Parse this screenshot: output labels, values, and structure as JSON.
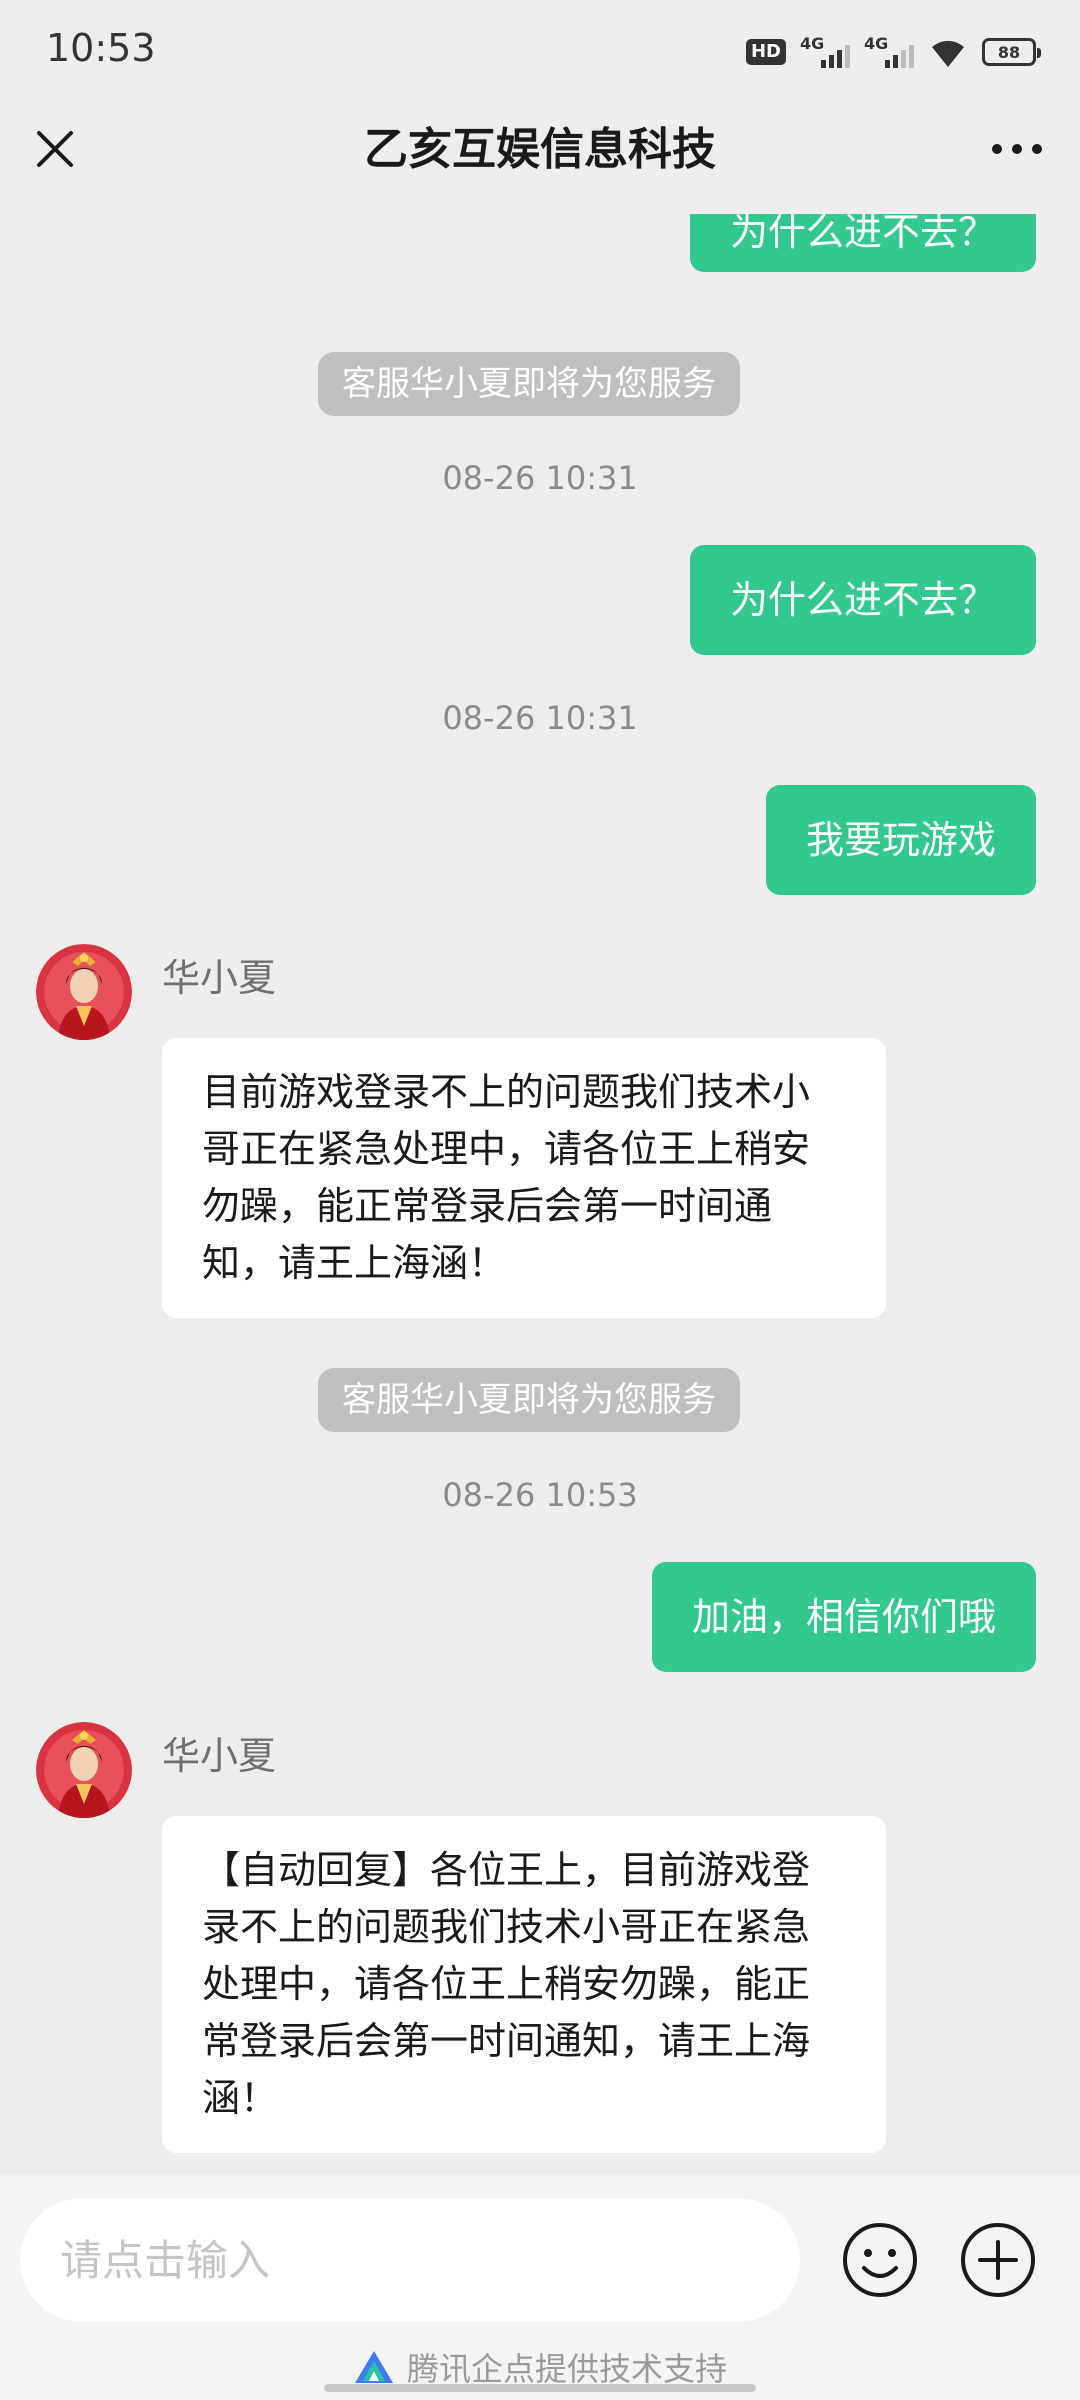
{
  "status_bar": {
    "time": "10:53",
    "hd_label": "HD",
    "network1": "4G",
    "network2": "4G",
    "battery": "88"
  },
  "header": {
    "title": "乙亥互娱信息科技"
  },
  "messages": [
    {
      "type": "out",
      "text": "为什么进不去？"
    },
    {
      "type": "system",
      "text": "客服华小夏即将为您服务"
    },
    {
      "type": "time",
      "text": "08-26 10:31"
    },
    {
      "type": "out",
      "text": "为什么进不去？"
    },
    {
      "type": "time",
      "text": "08-26 10:31"
    },
    {
      "type": "out",
      "text": "我要玩游戏"
    },
    {
      "type": "in",
      "sender": "华小夏",
      "text": "目前游戏登录不上的问题我们技术小哥正在紧急处理中，请各位王上稍安勿躁，能正常登录后会第一时间通知，请王上海涵！"
    },
    {
      "type": "system",
      "text": "客服华小夏即将为您服务"
    },
    {
      "type": "time",
      "text": "08-26 10:53"
    },
    {
      "type": "out",
      "text": "加油，相信你们哦"
    },
    {
      "type": "in",
      "sender": "华小夏",
      "text": "【自动回复】各位王上，目前游戏登录不上的问题我们技术小哥正在紧急处理中，请各位王上稍安勿躁，能正常登录后会第一时间通知，请王上海涵！"
    }
  ],
  "input": {
    "placeholder": "请点击输入",
    "value": ""
  },
  "footer": {
    "text": "腾讯企点提供技术支持"
  },
  "colors": {
    "accent": "#33c88d",
    "background": "#ededed",
    "system_pill": "#bfbfbf"
  },
  "icons": {
    "close": "close-icon",
    "more": "more-icon",
    "emoji": "emoji-icon",
    "plus": "plus-icon",
    "logo": "qidian-logo-icon"
  }
}
